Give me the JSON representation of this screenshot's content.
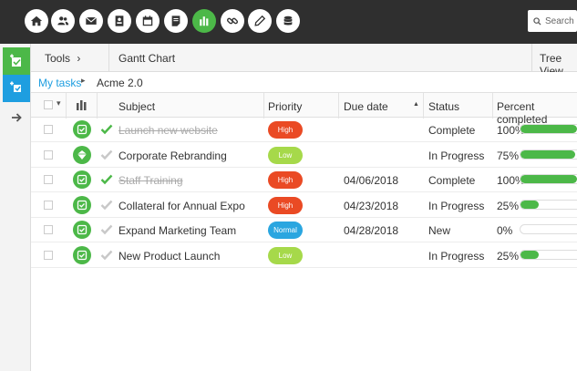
{
  "colors": {
    "accent": "#4cb848",
    "blue": "#1e9ee0",
    "high": "#ea4a24",
    "low": "#a6d94a",
    "normal": "#2aa6e0",
    "topbar": "#2f2f2f"
  },
  "topnav": {
    "icons": [
      "home-icon",
      "users-icon",
      "mail-icon",
      "contact-card-icon",
      "calendar-icon",
      "notes-icon",
      "bar-chart-icon",
      "link-icon",
      "pen-icon",
      "database-icon"
    ],
    "search_placeholder": "Search"
  },
  "toolbar": {
    "tools_label": "Tools",
    "tools_arrow": "›",
    "gantt_label": "Gantt Chart",
    "view_label": "Tree View",
    "view_menu": "≡ ⁝"
  },
  "breadcrumb": {
    "link": "My tasks",
    "arrow": "▸",
    "current": "Acme 2.0"
  },
  "table": {
    "headers": {
      "subject": "Subject",
      "priority": "Priority",
      "due": "Due date",
      "sort": "▲",
      "status": "Status",
      "percent": "Percent completed",
      "dropdown": "▾"
    },
    "rows": [
      {
        "subject": "Launch new website",
        "done": true,
        "icon": "task-check-icon",
        "priority": "High",
        "due": "",
        "status": "Complete",
        "percent_label": "100%",
        "percent": 100
      },
      {
        "subject": "Corporate Rebranding",
        "done": false,
        "icon": "diamond-icon",
        "priority": "Low",
        "due": "",
        "status": "In Progress",
        "percent_label": "75%",
        "percent": 75
      },
      {
        "subject": "Staff Training",
        "done": true,
        "icon": "task-check-icon",
        "priority": "High",
        "due": "04/06/2018",
        "status": "Complete",
        "percent_label": "100%",
        "percent": 100
      },
      {
        "subject": "Collateral for Annual Expo",
        "done": false,
        "icon": "task-check-icon",
        "priority": "High",
        "due": "04/23/2018",
        "status": "In Progress",
        "percent_label": "25%",
        "percent": 25
      },
      {
        "subject": "Expand Marketing Team",
        "done": false,
        "icon": "task-check-icon",
        "priority": "Normal",
        "due": "04/28/2018",
        "status": "New",
        "percent_label": "0%",
        "percent": 0
      },
      {
        "subject": "New Product Launch",
        "done": false,
        "icon": "task-check-icon",
        "priority": "Low",
        "due": "",
        "status": "In Progress",
        "percent_label": "25%",
        "percent": 25
      }
    ]
  }
}
